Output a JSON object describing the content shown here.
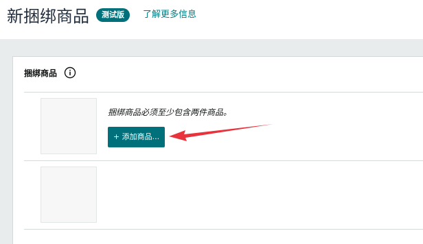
{
  "header": {
    "title": "新捆绑商品",
    "badge": "测试版",
    "learn_more": "了解更多信息"
  },
  "bundle_section": {
    "title": "捆绑商品",
    "info_icon": "info-circle-icon",
    "requirement_note": "捆绑商品必须至少包含两件商品。",
    "add_button_label": "+ 添加商品..."
  },
  "colors": {
    "accent": "#00707a",
    "link": "#007e85",
    "backdrop": "#e9ecec",
    "annotation_arrow": "#e8323c"
  }
}
